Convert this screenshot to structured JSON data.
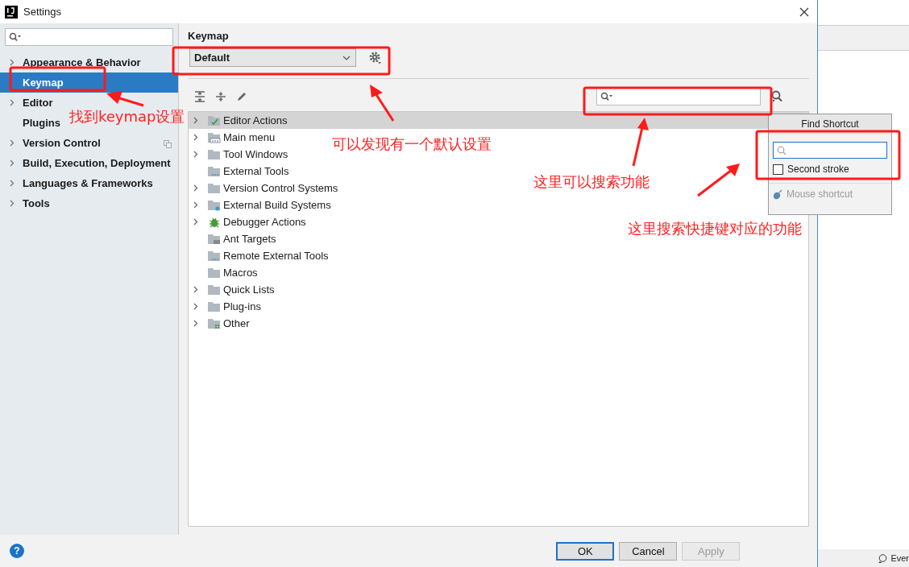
{
  "window": {
    "title": "Settings"
  },
  "sidebar": {
    "items": [
      {
        "label": "Appearance & Behavior",
        "expandable": true,
        "selected": false
      },
      {
        "label": "Keymap",
        "expandable": false,
        "selected": true
      },
      {
        "label": "Editor",
        "expandable": true,
        "selected": false
      },
      {
        "label": "Plugins",
        "expandable": false,
        "selected": false
      },
      {
        "label": "Version Control",
        "expandable": true,
        "selected": false
      },
      {
        "label": "Build, Execution, Deployment",
        "expandable": true,
        "selected": false
      },
      {
        "label": "Languages & Frameworks",
        "expandable": true,
        "selected": false
      },
      {
        "label": "Tools",
        "expandable": true,
        "selected": false
      }
    ]
  },
  "keymap": {
    "title": "Keymap",
    "scheme": "Default",
    "tree": [
      {
        "label": "Editor Actions",
        "kind": "folder-edit",
        "expandable": true,
        "selected": true
      },
      {
        "label": "Main menu",
        "kind": "menu",
        "expandable": true,
        "selected": false
      },
      {
        "label": "Tool Windows",
        "kind": "folder",
        "expandable": true,
        "selected": false
      },
      {
        "label": "External Tools",
        "kind": "tools",
        "expandable": false,
        "selected": false
      },
      {
        "label": "Version Control Systems",
        "kind": "folder",
        "expandable": true,
        "selected": false
      },
      {
        "label": "External Build Systems",
        "kind": "build",
        "expandable": true,
        "selected": false
      },
      {
        "label": "Debugger Actions",
        "kind": "bug",
        "expandable": true,
        "selected": false
      },
      {
        "label": "Ant Targets",
        "kind": "ant",
        "expandable": false,
        "selected": false
      },
      {
        "label": "Remote External Tools",
        "kind": "tools",
        "expandable": false,
        "selected": false
      },
      {
        "label": "Macros",
        "kind": "folder",
        "expandable": false,
        "selected": false
      },
      {
        "label": "Quick Lists",
        "kind": "folder",
        "expandable": true,
        "selected": false
      },
      {
        "label": "Plug-ins",
        "kind": "folder",
        "expandable": true,
        "selected": false
      },
      {
        "label": "Other",
        "kind": "other",
        "expandable": true,
        "selected": false
      }
    ]
  },
  "find_shortcut": {
    "title": "Find Shortcut",
    "second_stroke": {
      "label": "Second stroke",
      "checked": false
    },
    "mouse_shortcut": {
      "label": "Mouse shortcut",
      "disabled": true
    }
  },
  "help": "?",
  "buttons": [
    {
      "label": "OK",
      "kind": "default"
    },
    {
      "label": "Cancel",
      "kind": "normal"
    },
    {
      "label": "Apply",
      "kind": "disabled"
    }
  ],
  "background_window": {
    "status_text": "Ever"
  },
  "annotations": [
    {
      "text": "找到keymap设置"
    },
    {
      "text": "可以发现有一个默认设置"
    },
    {
      "text": "这里可以搜索功能"
    },
    {
      "text": "这里搜索快捷键对应的功能"
    }
  ]
}
